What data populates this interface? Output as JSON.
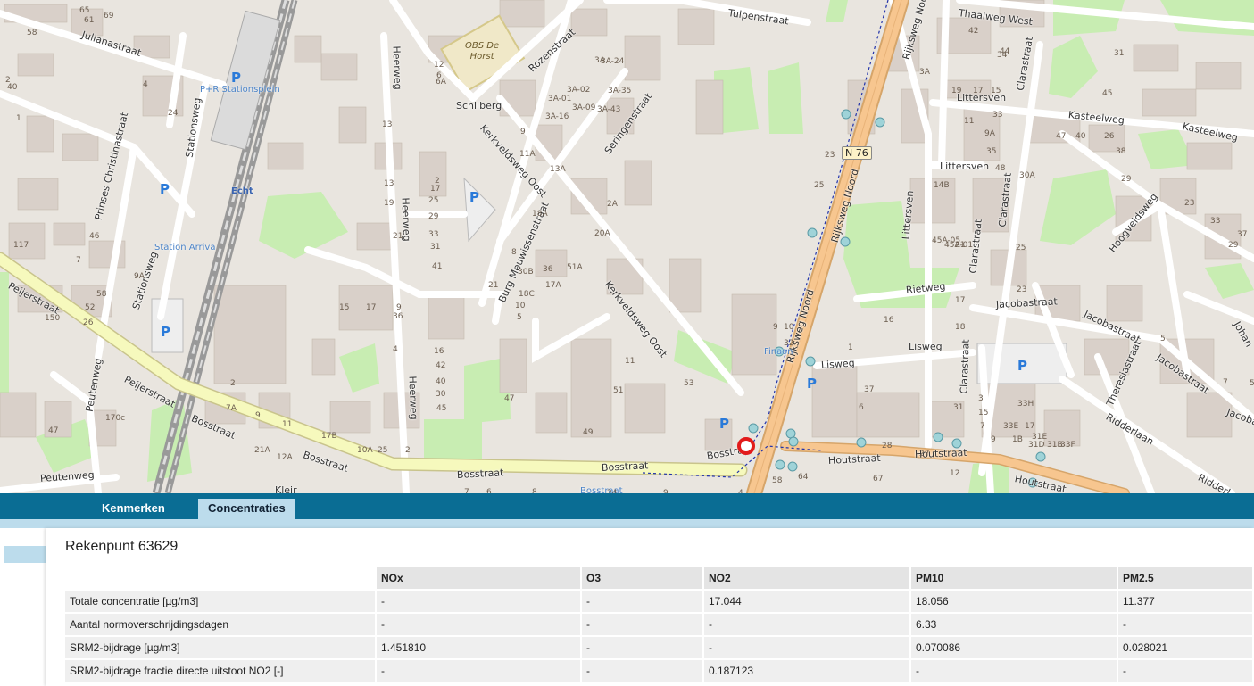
{
  "map": {
    "streets": [
      "Julianastraat",
      "Stationsweg",
      "Prinses Christinastraat",
      "Stationsweg",
      "Peijerstraat",
      "Peijerstraat",
      "Peutenweg",
      "Peutenweg",
      "Bosstraat",
      "Bosstraat",
      "Bosstraat",
      "Bosstraat",
      "Bosstraat",
      "Heerweg",
      "Heerweg",
      "Heerweg",
      "Heerweg",
      "Schilberg",
      "Rozenstraat",
      "Kerkveldsweg Oost",
      "Seringenstraat",
      "Burg Meuwissenstraat",
      "Kerkveldsweg Oost",
      "Tulpenstraat",
      "Rijksweg Noord",
      "Rijksweg Noord",
      "Rijksweg Noord",
      "Thaalweg West",
      "Clarastraat",
      "Littersven",
      "Littersven",
      "Littersven",
      "Kasteelweg",
      "Kasteelweg",
      "Clarastraat",
      "Clarastraat",
      "Clarastraat",
      "Hoogveldsweg",
      "Rietweg",
      "Jacobastraat",
      "Jacobastraat",
      "Jacobastraat",
      "Jacobastraat",
      "Theresiastraat",
      "Ridderlaan",
      "Ridderl",
      "Lisweg",
      "Lisweg",
      "Houtstraat",
      "Houtstraat",
      "Houtstraat",
      "Kleir",
      "Johan"
    ],
    "pois": [
      "P+R Stationsplein",
      "Echt",
      "Station Arriva",
      "Bosstraat",
      "Fina",
      "on"
    ],
    "shield": "N 76",
    "school": [
      "OBS De",
      "Horst"
    ],
    "parking": "P",
    "house_numbers": [
      "65",
      "61",
      "69",
      "58",
      "40",
      "4",
      "24",
      "2",
      "1",
      "117",
      "7",
      "46",
      "58",
      "52",
      "26",
      "150",
      "9A",
      "47",
      "170c",
      "2",
      "7A",
      "9",
      "11",
      "17B",
      "12A",
      "10A",
      "21A",
      "25",
      "2",
      "6",
      "12",
      "13",
      "6A",
      "3A",
      "3A-01",
      "3A-02",
      "3A-24",
      "3A-09",
      "3A-35",
      "3A-43",
      "3A-16",
      "9",
      "11A",
      "13A",
      "2A",
      "18A",
      "2",
      "8",
      "10",
      "5",
      "21",
      "17",
      "33",
      "31",
      "41",
      "25",
      "29",
      "13",
      "19",
      "21",
      "9",
      "4",
      "36",
      "15",
      "17",
      "11",
      "16",
      "42",
      "40",
      "30",
      "45",
      "47",
      "49",
      "51",
      "53",
      "20A",
      "51A",
      "30B",
      "36",
      "17A",
      "18C",
      "7",
      "6",
      "8",
      "9",
      "10",
      "32",
      "23",
      "25",
      "3A",
      "15",
      "17",
      "19",
      "11",
      "9A",
      "35",
      "48",
      "44",
      "42",
      "34",
      "33",
      "31",
      "29",
      "23",
      "33",
      "29",
      "37",
      "45",
      "47",
      "40",
      "26",
      "38",
      "30A",
      "14B",
      "45A-05",
      "45A-01",
      "21",
      "25",
      "23",
      "17",
      "16",
      "18",
      "5",
      "7",
      "1",
      "6",
      "3",
      "31",
      "7",
      "9",
      "15",
      "17",
      "1B",
      "31E",
      "31D",
      "31B",
      "33F",
      "33E",
      "33H",
      "37",
      "28",
      "27",
      "24",
      "9",
      "4",
      "54",
      "58",
      "64",
      "67",
      "12",
      "1",
      "6",
      "5"
    ]
  },
  "tabs": [
    {
      "label": "Kenmerken",
      "active": false
    },
    {
      "label": "Concentraties",
      "active": true
    }
  ],
  "panel": {
    "title": "Rekenpunt 63629",
    "columns": [
      "NOx",
      "O3",
      "NO2",
      "PM10",
      "PM2.5"
    ],
    "rows": [
      {
        "label": "Totale concentratie [µg/m3]",
        "values": [
          "-",
          "-",
          "17.044",
          "18.056",
          "11.377"
        ]
      },
      {
        "label": "Aantal normoverschrijdingsdagen",
        "values": [
          "-",
          "-",
          "-",
          "6.33",
          "-"
        ]
      },
      {
        "label": "SRM2-bijdrage [µg/m3]",
        "values": [
          "1.451810",
          "-",
          "-",
          "0.070086",
          "0.028021"
        ]
      },
      {
        "label": "SRM2-bijdrage fractie directe uitstoot NO2 [-]",
        "values": [
          "-",
          "-",
          "0.187123",
          "-",
          "-"
        ]
      }
    ]
  },
  "colors": {
    "tabbar": "#0a6d94",
    "tab_active": "#bcdcec",
    "marker": "#e21b1b",
    "main_road": "#f7c68f",
    "secondary_road": "#f6f9bd",
    "park": "#c8edb2"
  }
}
